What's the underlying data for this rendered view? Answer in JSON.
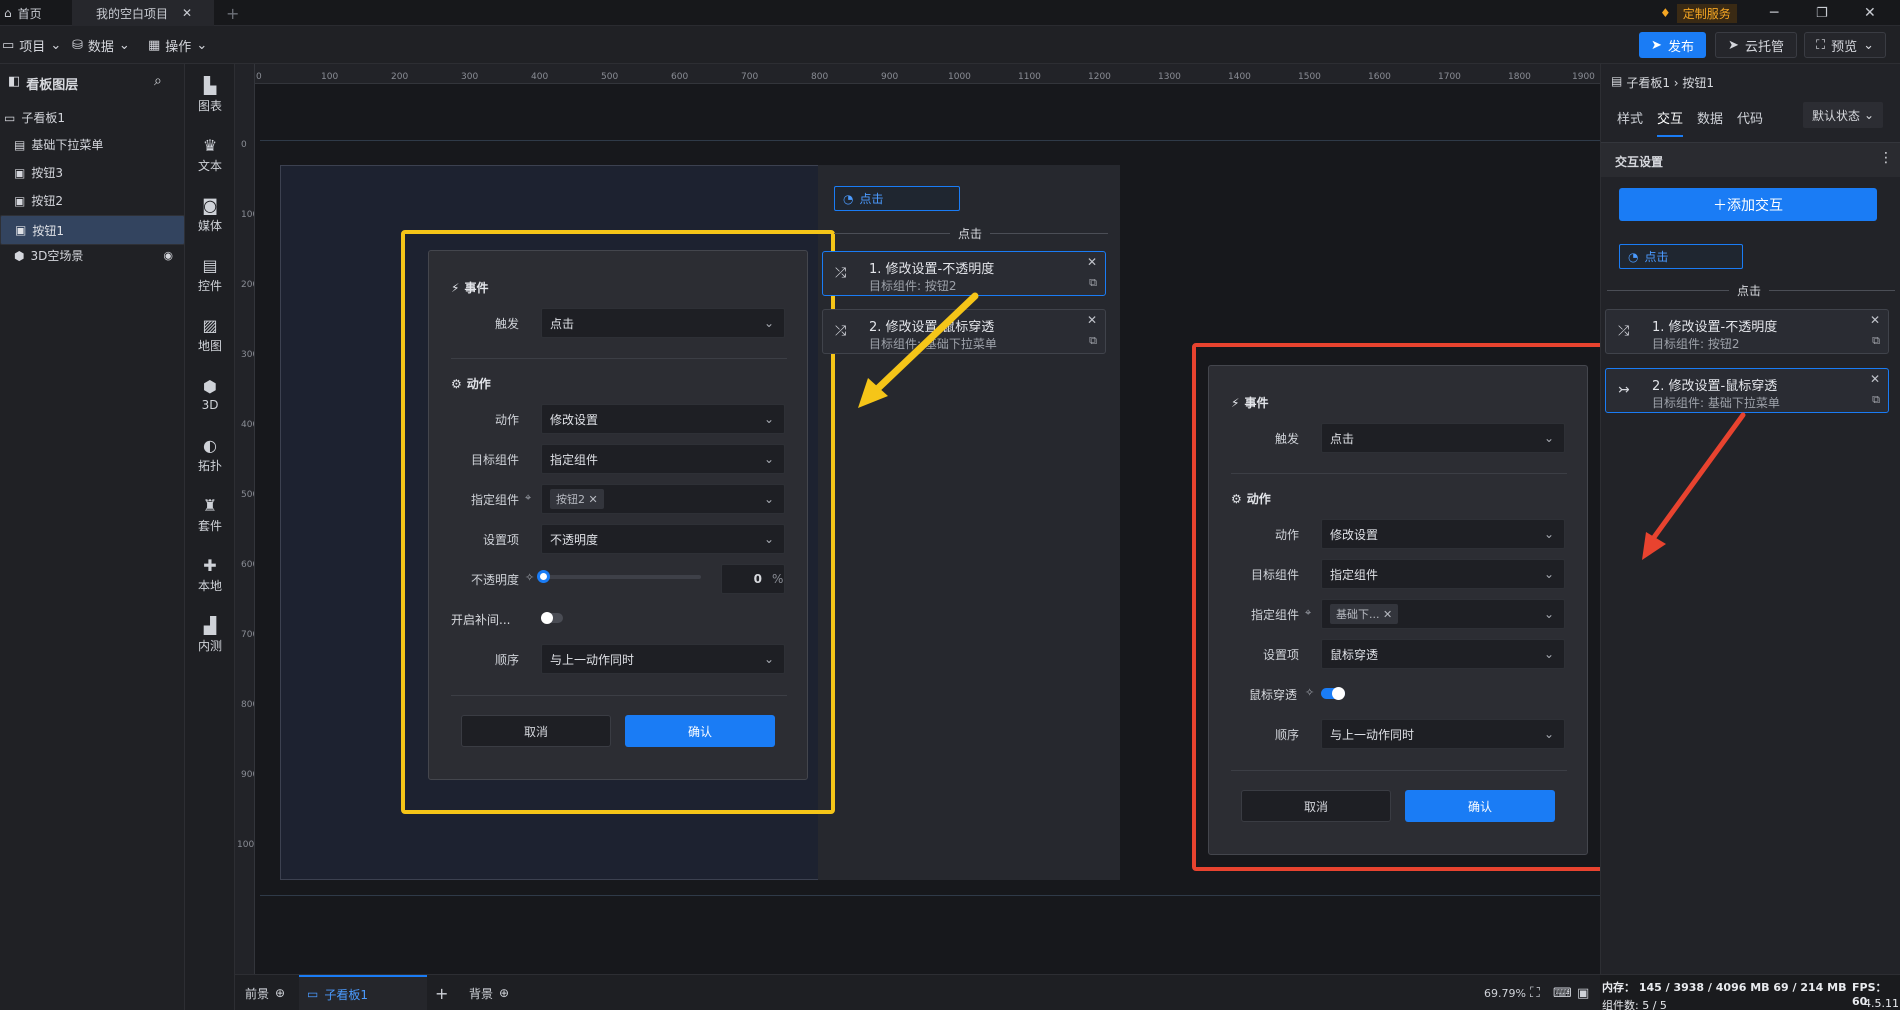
{
  "tabs": [
    {
      "label": "首页"
    },
    {
      "label": "我的空白项目"
    }
  ],
  "top_right": {
    "custom_service": "定制服务"
  },
  "menu": {
    "project": "项目",
    "data": "数据",
    "operation": "操作"
  },
  "toolbar": {
    "publish": "发布",
    "cloud_host": "云托管",
    "preview": "预览"
  },
  "layers": {
    "title": "看板图层",
    "items": [
      {
        "label": "子看板1"
      },
      {
        "label": "基础下拉菜单"
      },
      {
        "label": "按钮3"
      },
      {
        "label": "按钮2"
      },
      {
        "label": "按钮1"
      },
      {
        "label": "3D空场景"
      }
    ]
  },
  "tools": [
    {
      "label": "图表"
    },
    {
      "label": "文本"
    },
    {
      "label": "媒体"
    },
    {
      "label": "控件"
    },
    {
      "label": "地图"
    },
    {
      "label": "3D"
    },
    {
      "label": "拓扑"
    },
    {
      "label": "套件"
    },
    {
      "label": "本地"
    },
    {
      "label": "内测"
    }
  ],
  "ruler": {
    "h": [
      "0",
      "100",
      "200",
      "300",
      "400",
      "500",
      "600",
      "700",
      "800",
      "900",
      "1000",
      "1100",
      "1200",
      "1300",
      "1400",
      "1500",
      "1600",
      "1700",
      "1800",
      "1900"
    ],
    "v": [
      "0",
      "100",
      "200",
      "300",
      "400",
      "500",
      "600",
      "700",
      "800",
      "900",
      "1000"
    ]
  },
  "dialog_left": {
    "event_title": "事件",
    "trigger_label": "触发",
    "trigger_value": "点击",
    "action_title": "动作",
    "action_label": "动作",
    "action_value": "修改设置",
    "target_label": "目标组件",
    "target_value": "指定组件",
    "spec_label": "指定组件",
    "spec_tag": "按钮2",
    "setting_label": "设置项",
    "setting_value": "不透明度",
    "opacity_label": "不透明度",
    "opacity_value": "0",
    "opacity_unit": "%",
    "tween_label": "开启补间...",
    "order_label": "顺序",
    "order_value": "与上一动作同时",
    "cancel": "取消",
    "confirm": "确认"
  },
  "middle": {
    "trigger": "点击",
    "header": "点击",
    "cards": [
      {
        "title": "1. 修改设置-不透明度",
        "sub": "目标组件: 按钮2"
      },
      {
        "title": "2. 修改设置-鼠标穿透",
        "sub": "目标组件: 基础下拉菜单"
      }
    ]
  },
  "dialog_right": {
    "event_title": "事件",
    "trigger_label": "触发",
    "trigger_value": "点击",
    "action_title": "动作",
    "action_label": "动作",
    "action_value": "修改设置",
    "target_label": "目标组件",
    "target_value": "指定组件",
    "spec_label": "指定组件",
    "spec_tag": "基础下...",
    "setting_label": "设置项",
    "setting_value": "鼠标穿透",
    "mouse_label": "鼠标穿透",
    "order_label": "顺序",
    "order_value": "与上一动作同时",
    "cancel": "取消",
    "confirm": "确认"
  },
  "right_panel": {
    "breadcrumb": "子看板1 › 按钮1",
    "tabs": [
      {
        "label": "样式"
      },
      {
        "label": "交互"
      },
      {
        "label": "数据"
      },
      {
        "label": "代码"
      }
    ],
    "state": "默认状态",
    "section": "交互设置",
    "add": "＋添加交互",
    "trigger": "点击",
    "header": "点击",
    "cards": [
      {
        "title": "1. 修改设置-不透明度",
        "sub": "目标组件: 按钮2"
      },
      {
        "title": "2. 修改设置-鼠标穿透",
        "sub": "目标组件: 基础下拉菜单"
      }
    ]
  },
  "bottom": {
    "front": "前景",
    "board": "子看板1",
    "background": "背景",
    "zoom": "69.79%"
  },
  "status": {
    "memory": "内存： 145 / 3938 / 4096 MB  69 / 214 MB",
    "fps": "FPS： 60",
    "components": "组件数: 5 / 5",
    "version": "4.5.11"
  },
  "colors": {
    "accent": "#1a7cf5",
    "highlight_yellow": "#f5c518",
    "highlight_red": "#e8432f"
  }
}
